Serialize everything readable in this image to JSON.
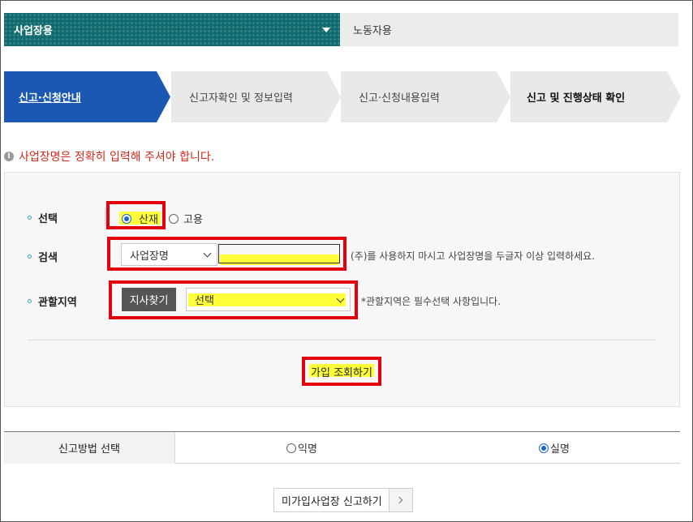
{
  "top_tabs": {
    "business": "사업장용",
    "worker": "노동자용"
  },
  "steps": [
    {
      "label": "신고·신청안내",
      "active": true
    },
    {
      "label": "신고자확인 및 정보입력",
      "active": false
    },
    {
      "label": "신고·신청내용입력",
      "active": false
    },
    {
      "label": "신고 및 진행상태 확인",
      "active": false
    }
  ],
  "notice": {
    "icon": "info-icon",
    "text": "사업장명은 정확히 입력해 주셔야 합니다."
  },
  "form": {
    "select_row": {
      "label": "선택",
      "options": [
        {
          "label": "산재",
          "checked": true
        },
        {
          "label": "고용",
          "checked": false
        }
      ]
    },
    "search_row": {
      "label": "검색",
      "select_value": "사업장명",
      "input_value": "",
      "help": "(주)를 사용하지 마시고 사업장명을 두글자 이상 입력하세요."
    },
    "region_row": {
      "label": "관할지역",
      "branch_button": "지사찾기",
      "select_value": "선택",
      "help": "*관할지역은 필수선택 사항입니다."
    },
    "submit_label": "가입 조회하기"
  },
  "method": {
    "label": "신고방법 선택",
    "options": [
      {
        "label": "익명",
        "checked": false
      },
      {
        "label": "실명",
        "checked": true
      }
    ]
  },
  "report_button": "미가입사업장 신고하기",
  "colors": {
    "accent_teal": "#0f6b6e",
    "step_active": "#1b58b3",
    "notice_red": "#d2291d",
    "highlight_box": "#e3000f",
    "highlight_marker": "#ffff3a"
  }
}
